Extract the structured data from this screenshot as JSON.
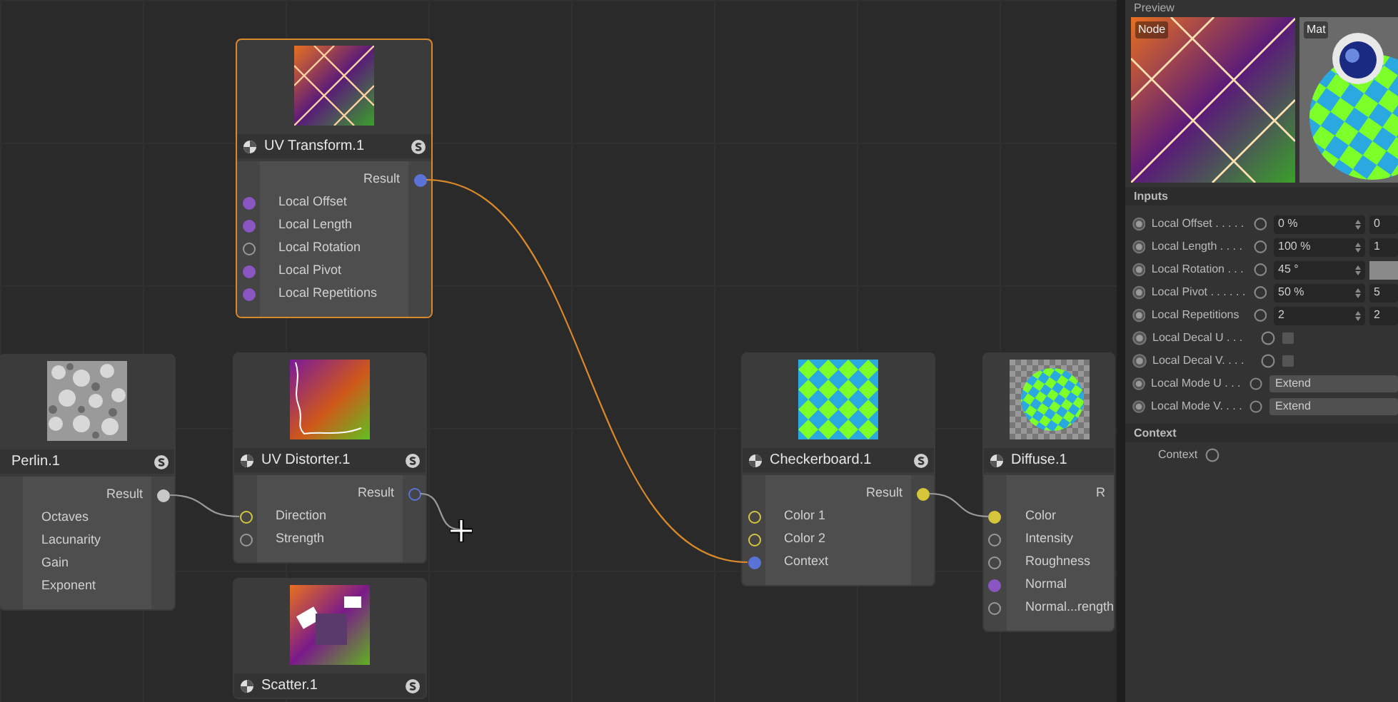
{
  "nodes": [
    {
      "title": "UV Transform.1",
      "selected": true,
      "type_icon": true,
      "solo_icon": true,
      "outputs": [
        {
          "label": "Result",
          "color": "#5b73d6",
          "kind": "filled"
        }
      ],
      "inputs": [
        {
          "label": "Local Offset",
          "color": "#8a56c2",
          "kind": "filled"
        },
        {
          "label": "Local Length",
          "color": "#8a56c2",
          "kind": "filled"
        },
        {
          "label": "Local Rotation",
          "color": "#9a9a9a",
          "kind": "ring"
        },
        {
          "label": "Local Pivot",
          "color": "#8a56c2",
          "kind": "filled"
        },
        {
          "label": "Local Repetitions",
          "color": "#8a56c2",
          "kind": "filled"
        }
      ]
    },
    {
      "title": "Perlin.1",
      "selected": false,
      "type_icon": false,
      "solo_icon": true,
      "outputs": [
        {
          "label": "Result",
          "color": "#c8c8c8",
          "kind": "filled"
        }
      ],
      "inputs": [
        {
          "label": "Octaves"
        },
        {
          "label": "Lacunarity"
        },
        {
          "label": "Gain"
        },
        {
          "label": "Exponent"
        }
      ]
    },
    {
      "title": "UV Distorter.1",
      "selected": false,
      "type_icon": true,
      "solo_icon": true,
      "outputs": [
        {
          "label": "Result",
          "color": "#5b73d6",
          "kind": "ring"
        }
      ],
      "inputs": [
        {
          "label": "Direction",
          "color": "#d6c63c",
          "kind": "ring"
        },
        {
          "label": "Strength",
          "color": "#9a9a9a",
          "kind": "ring"
        }
      ]
    },
    {
      "title": "Scatter.1",
      "selected": false,
      "type_icon": true,
      "solo_icon": true
    },
    {
      "title": "Checkerboard.1",
      "selected": false,
      "type_icon": true,
      "solo_icon": true,
      "outputs": [
        {
          "label": "Result",
          "color": "#d6c63c",
          "kind": "filled"
        }
      ],
      "inputs": [
        {
          "label": "Color 1",
          "color": "#d6c63c",
          "kind": "ring"
        },
        {
          "label": "Color 2",
          "color": "#d6c63c",
          "kind": "ring"
        },
        {
          "label": "Context",
          "color": "#5b73d6",
          "kind": "filled"
        }
      ]
    },
    {
      "title": "Diffuse.1",
      "selected": false,
      "type_icon": true,
      "solo_icon": false,
      "outputs": [
        {
          "label": "R"
        }
      ],
      "inputs": [
        {
          "label": "Color",
          "color": "#d6c63c",
          "kind": "filled"
        },
        {
          "label": "Intensity",
          "color": "#9a9a9a",
          "kind": "ring"
        },
        {
          "label": "Roughness",
          "color": "#9a9a9a",
          "kind": "ring"
        },
        {
          "label": "Normal",
          "color": "#8a56c2",
          "kind": "filled"
        },
        {
          "label": "Normal...rength",
          "color": "#9a9a9a",
          "kind": "ring"
        }
      ]
    }
  ],
  "panel": {
    "title": "Preview",
    "node_label": "Node",
    "material_label": "Mat",
    "inputs_title": "Inputs",
    "rows": [
      {
        "label": "Local Offset . . . . .",
        "kind": "number",
        "value": "0 %",
        "value2": "0"
      },
      {
        "label": "Local Length . . . .",
        "kind": "number",
        "value": "100 %",
        "value2": "1"
      },
      {
        "label": "Local Rotation . . .",
        "kind": "number",
        "value": "45 °"
      },
      {
        "label": "Local Pivot . . . . . .",
        "kind": "number",
        "value": "50 %",
        "value2": "5"
      },
      {
        "label": "Local Repetitions",
        "kind": "number",
        "value": "2",
        "value2": "2"
      },
      {
        "label": "Local Decal U . . .",
        "kind": "checkbox",
        "checked": false
      },
      {
        "label": "Local Decal V. . . .",
        "kind": "checkbox",
        "checked": false
      },
      {
        "label": "Local Mode U . . .",
        "kind": "dropdown",
        "value": "Extend"
      },
      {
        "label": "Local Mode V. . . .",
        "kind": "dropdown",
        "value": "Extend"
      }
    ],
    "context_title": "Context",
    "context_label": "Context"
  }
}
